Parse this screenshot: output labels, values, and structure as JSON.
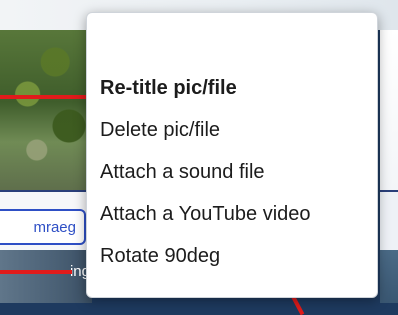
{
  "language_tab": {
    "label": "mraeg"
  },
  "bottom_left_text": "ing",
  "context_menu": {
    "items": [
      {
        "label": "Re-title pic/file",
        "bold": true
      },
      {
        "label": "Delete pic/file",
        "bold": false
      },
      {
        "label": "Attach a sound file",
        "bold": false
      },
      {
        "label": "Attach a YouTube video",
        "bold": false
      },
      {
        "label": "Rotate 90deg",
        "bold": false
      }
    ]
  },
  "colors": {
    "accent": "#2e4fc5",
    "indicator": "#e11b1b"
  }
}
